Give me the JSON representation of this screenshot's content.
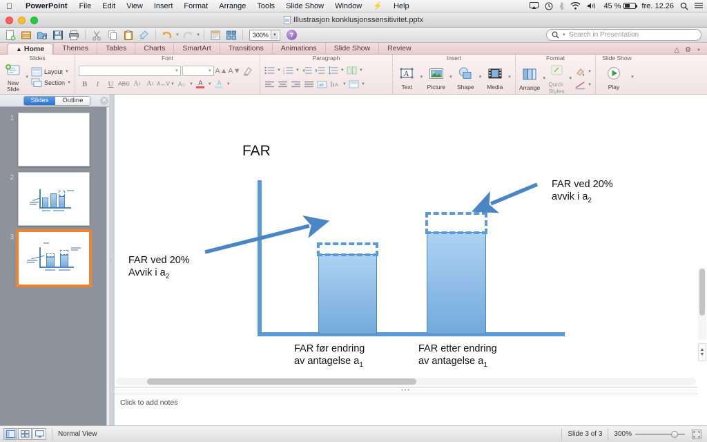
{
  "menubar": {
    "apple": "apple-logo",
    "app_name": "PowerPoint",
    "items": [
      "File",
      "Edit",
      "View",
      "Insert",
      "Format",
      "Arrange",
      "Tools",
      "Slide Show",
      "Window"
    ],
    "script_icon": "script-menu-icon",
    "help": "Help",
    "status": {
      "airplay": "airplay-icon",
      "timemachine": "time-machine-icon",
      "bluetooth": "bluetooth-icon",
      "wifi": "wifi-icon",
      "volume": "volume-icon",
      "battery_percent": "45 %",
      "clock": "fre. 12.26",
      "search": "spotlight-icon",
      "notifications": "notification-center-icon"
    }
  },
  "window": {
    "title": "Illustrasjon konklusjonssensitivitet.pptx"
  },
  "toolbar": {
    "buttons": [
      "new-icon",
      "open-icon",
      "save-as-icon",
      "save-icon",
      "print-icon",
      "cut-icon",
      "copy-icon",
      "paste-icon",
      "format-painter-icon",
      "undo-icon",
      "redo-icon",
      "media-browser-icon",
      "smart-art-icon"
    ],
    "zoom_value": "300%",
    "help_label": "?",
    "search_placeholder": "Search in Presentation"
  },
  "ribbon": {
    "tabs": [
      {
        "label": "Home",
        "active": true
      },
      {
        "label": "Themes",
        "active": false
      },
      {
        "label": "Tables",
        "active": false
      },
      {
        "label": "Charts",
        "active": false
      },
      {
        "label": "SmartArt",
        "active": false
      },
      {
        "label": "Transitions",
        "active": false
      },
      {
        "label": "Animations",
        "active": false
      },
      {
        "label": "Slide Show",
        "active": false
      },
      {
        "label": "Review",
        "active": false
      }
    ],
    "collapse_icon": "chevron-up-icon",
    "settings_icon": "gear-icon",
    "groups": [
      {
        "title": "Slides",
        "new_slide": "New Slide",
        "layout": "Layout",
        "section": "Section"
      },
      {
        "title": "Font",
        "font_name": "",
        "font_size": "",
        "grow": "A+",
        "shrink": "A-",
        "clear": "clear-formatting-icon",
        "bold": "B",
        "italic": "I",
        "underline": "U",
        "strikethrough": "ABC",
        "superscript": "A2",
        "subscript": "A2",
        "spacing": "character-spacing-icon",
        "effects": "text-effects-icon",
        "font_color": "font-color-icon",
        "highlight": "highlight-icon"
      },
      {
        "title": "Paragraph"
      },
      {
        "title": "Insert",
        "items": [
          {
            "label": "Text",
            "icon": "text-box-icon"
          },
          {
            "label": "Picture",
            "icon": "picture-icon"
          },
          {
            "label": "Shape",
            "icon": "shape-icon"
          },
          {
            "label": "Media",
            "icon": "media-icon"
          }
        ]
      },
      {
        "title": "Format",
        "items": [
          {
            "label": "Arrange",
            "icon": "arrange-icon"
          },
          {
            "label": "Quick Styles",
            "icon": "quick-styles-icon"
          }
        ]
      },
      {
        "title": "Slide Show",
        "items": [
          {
            "label": "Play",
            "icon": "play-icon"
          }
        ]
      }
    ]
  },
  "sidebar": {
    "tabs": [
      {
        "label": "Slides",
        "active": true
      },
      {
        "label": "Outline",
        "active": false
      }
    ],
    "close_icon": "close-icon",
    "slides": [
      {
        "number": "1",
        "selected": false,
        "has_chart": false
      },
      {
        "number": "2",
        "selected": false,
        "has_chart": true
      },
      {
        "number": "3",
        "selected": true,
        "has_chart": true
      }
    ]
  },
  "notes": {
    "placeholder": "Click to add notes"
  },
  "statusbar": {
    "view_buttons": [
      "normal-view-icon",
      "slide-sorter-icon",
      "presenter-view-icon"
    ],
    "view_label": "Normal View",
    "slide_counter": "Slide 3 of 3",
    "zoom_value": "300%",
    "fit_icon": "fit-to-window-icon"
  },
  "chart_data": {
    "type": "bar",
    "title": "FAR",
    "xlabel": "",
    "ylabel": "FAR",
    "categories": [
      "FAR før endring av antagelse a₁",
      "FAR etter endring av antagelse a₁"
    ],
    "category_lines": [
      [
        "FAR før endring",
        "av antagelse a",
        "1"
      ],
      [
        "FAR etter endring",
        "av antagelse a",
        "1"
      ]
    ],
    "series": [
      {
        "name": "FAR (solid)",
        "values": [
          52,
          62
        ],
        "style": "solid-fill"
      },
      {
        "name": "FAR ved 20% avvik (dashed extension)",
        "values": [
          58,
          80
        ],
        "style": "dashed-outline"
      }
    ],
    "ylim": [
      0,
      100
    ],
    "grid": false,
    "legend": "none",
    "annotations": [
      {
        "id": "left-annotation",
        "lines": [
          "FAR ved 20%",
          "Avvik i a"
        ],
        "subscript": "2",
        "target": "bar-1-dashed-top"
      },
      {
        "id": "right-annotation",
        "lines": [
          "FAR ved 20%",
          "avvik i a"
        ],
        "subscript": "2",
        "target": "bar-2-dashed-top"
      }
    ],
    "colors": {
      "bar_fill_top": "#aed2f0",
      "bar_fill_bottom": "#72aadd",
      "bar_border": "#4a86c4",
      "axis": "#5b9bd5",
      "dashed": "#5b9bd5",
      "arrow": "#4a86c4",
      "text": "#111111"
    }
  }
}
